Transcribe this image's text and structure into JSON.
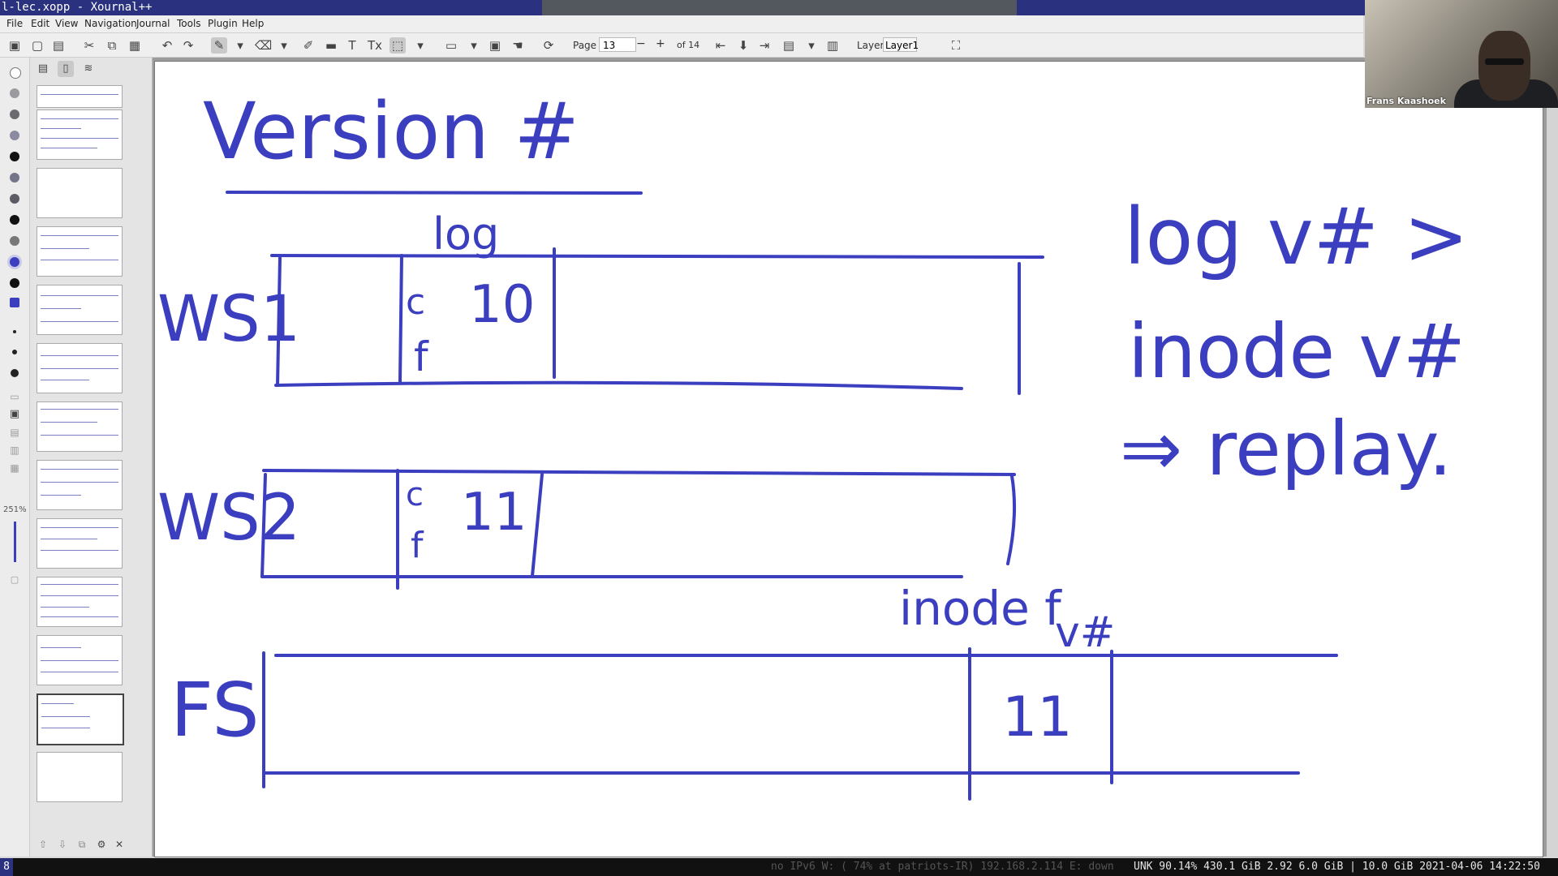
{
  "window": {
    "title": "l-lec.xopp - Xournal++"
  },
  "menu": [
    "File",
    "Edit",
    "View",
    "Navigation",
    "Journal",
    "Tools",
    "Plugin",
    "Help"
  ],
  "toolbar": {
    "page_label": "Page",
    "page_value": "13",
    "page_of": "of 14",
    "layer_label": "Layer",
    "layer_value": "Layer1"
  },
  "left_toolbar": {
    "zoom": "251%"
  },
  "webcam": {
    "name": "Frans Kaashoek"
  },
  "status": {
    "workspace": "8",
    "dimmed": "no IPv6 W: ( 74% at patriots-IR) 192.168.2.114 E: down",
    "text": "UNK 90.14% 430.1 GiB 2.92 6.0 GiB | 10.0 GiB 2021-04-06 14:22:50"
  },
  "ink_text": {
    "heading": "Version #",
    "log": "log",
    "ws1": "WS1",
    "ws2": "WS2",
    "fs": "FS",
    "ws1_entry_cells": [
      "c",
      "f"
    ],
    "ws1_version": "10",
    "ws2_entry_cells": [
      "c",
      "f"
    ],
    "ws2_version": "11",
    "inodef": "inode f",
    "vhash": "v#",
    "fs_version": "11",
    "note_line1": "log v# >",
    "note_line2": "inode v#",
    "note_line3": "⇒ replay."
  },
  "colors": {
    "ink": "#3b3fbf",
    "titlebar": "#2a3280"
  },
  "icons": [
    "new-doc-icon",
    "open-icon",
    "save-icon",
    "cut-icon",
    "copy-icon",
    "paste-icon",
    "undo-icon",
    "redo-icon",
    "pen-icon",
    "eraser-icon",
    "highlighter-icon",
    "shape-icon",
    "text-icon",
    "tex-icon",
    "image-icon",
    "select-icon",
    "hand-icon",
    "first-page-icon",
    "prev-page-icon",
    "next-page-icon",
    "last-page-icon",
    "fullscreen-icon"
  ]
}
